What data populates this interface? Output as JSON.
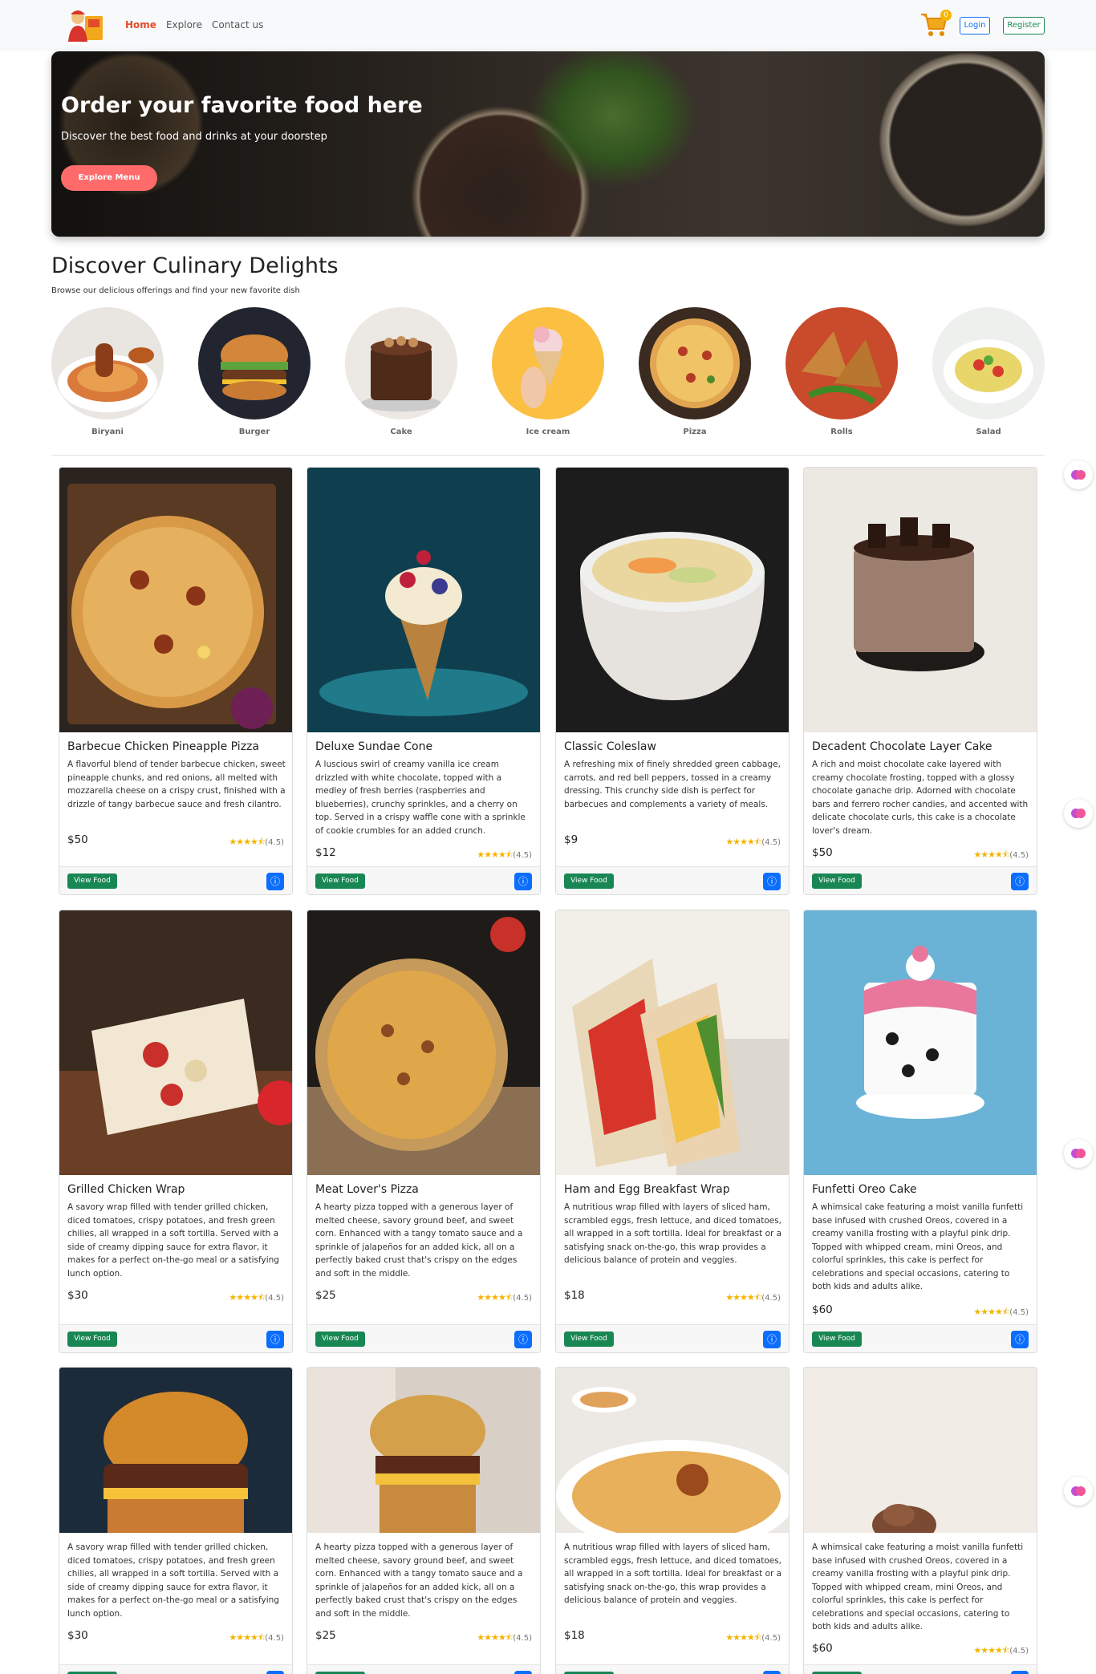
{
  "nav": {
    "links": [
      "Home",
      "Explore",
      "Contact us"
    ],
    "cart_count": "0",
    "login": "Login",
    "register": "Register"
  },
  "hero": {
    "title": "Order your favorite food here",
    "subtitle": "Discover the best food and drinks at your doorstep",
    "button": "Explore Menu"
  },
  "section": {
    "title": "Discover Culinary Delights",
    "subtitle": "Browse our delicious offerings and find your new favorite dish"
  },
  "categories": [
    "Biryani",
    "Burger",
    "Cake",
    "Ice cream",
    "Pizza",
    "Rolls",
    "Salad"
  ],
  "cards": [
    {
      "title": "Barbecue Chicken Pineapple Pizza",
      "desc": "A flavorful blend of tender barbecue chicken, sweet pineapple chunks, and red onions, all melted with mozzarella cheese on a crispy crust, finished with a drizzle of tangy barbecue sauce and fresh cilantro.",
      "price": "$50",
      "rating": "(4.5)"
    },
    {
      "title": "Deluxe Sundae Cone",
      "desc": "A luscious swirl of creamy vanilla ice cream drizzled with white chocolate, topped with a medley of fresh berries (raspberries and blueberries), crunchy sprinkles, and a cherry on top. Served in a crispy waffle cone with a sprinkle of cookie crumbles for an added crunch.",
      "price": "$12",
      "rating": "(4.5)"
    },
    {
      "title": "Classic Coleslaw",
      "desc": "A refreshing mix of finely shredded green cabbage, carrots, and red bell peppers, tossed in a creamy dressing. This crunchy side dish is perfect for barbecues and complements a variety of meals.",
      "price": "$9",
      "rating": "(4.5)"
    },
    {
      "title": "Decadent Chocolate Layer Cake",
      "desc": "A rich and moist chocolate cake layered with creamy chocolate frosting, topped with a glossy chocolate ganache drip. Adorned with chocolate bars and ferrero rocher candies, and accented with delicate chocolate curls, this cake is a chocolate lover's dream.",
      "price": "$50",
      "rating": "(4.5)"
    },
    {
      "title": "Grilled Chicken Wrap",
      "desc": "A savory wrap filled with tender grilled chicken, diced tomatoes, crispy potatoes, and fresh green chilies, all wrapped in a soft tortilla. Served with a side of creamy dipping sauce for extra flavor, it makes for a perfect on-the-go meal or a satisfying lunch option.",
      "price": "$30",
      "rating": "(4.5)"
    },
    {
      "title": "Meat Lover's Pizza",
      "desc": "A hearty pizza topped with a generous layer of melted cheese, savory ground beef, and sweet corn. Enhanced with a tangy tomato sauce and a sprinkle of jalapeños for an added kick, all on a perfectly baked crust that's crispy on the edges and soft in the middle.",
      "price": "$25",
      "rating": "(4.5)"
    },
    {
      "title": "Ham and Egg Breakfast Wrap",
      "desc": "A nutritious wrap filled with layers of sliced ham, scrambled eggs, fresh lettuce, and diced tomatoes, all wrapped in a soft tortilla. Ideal for breakfast or a satisfying snack on-the-go, this wrap provides a delicious balance of protein and veggies.",
      "price": "$18",
      "rating": "(4.5)"
    },
    {
      "title": "Funfetti Oreo Cake",
      "desc": "A whimsical cake featuring a moist vanilla funfetti base infused with crushed Oreos, covered in a creamy vanilla frosting with a playful pink drip. Topped with whipped cream, mini Oreos, and colorful sprinkles, this cake is perfect for celebrations and special occasions, catering to both kids and adults alike.",
      "price": "$60",
      "rating": "(4.5)"
    },
    {
      "title": "",
      "desc": "A savory wrap filled with tender grilled chicken, diced tomatoes, crispy potatoes, and fresh green chilies, all wrapped in a soft tortilla. Served with a side of creamy dipping sauce for extra flavor, it makes for a perfect on-the-go meal or a satisfying lunch option.",
      "price": "$30",
      "rating": "(4.5)"
    },
    {
      "title": "",
      "desc": "A hearty pizza topped with a generous layer of melted cheese, savory ground beef, and sweet corn. Enhanced with a tangy tomato sauce and a sprinkle of jalapeños for an added kick, all on a perfectly baked crust that's crispy on the edges and soft in the middle.",
      "price": "$25",
      "rating": "(4.5)"
    },
    {
      "title": "",
      "desc": "A nutritious wrap filled with layers of sliced ham, scrambled eggs, fresh lettuce, and diced tomatoes, all wrapped in a soft tortilla. Ideal for breakfast or a satisfying snack on-the-go, this wrap provides a delicious balance of protein and veggies.",
      "price": "$18",
      "rating": "(4.5)"
    },
    {
      "title": "",
      "desc": "A whimsical cake featuring a moist vanilla funfetti base infused with crushed Oreos, covered in a creamy vanilla frosting with a playful pink drip. Topped with whipped cream, mini Oreos, and colorful sprinkles, this cake is perfect for celebrations and special occasions, catering to both kids and adults alike.",
      "price": "$60",
      "rating": "(4.5)"
    }
  ],
  "card_ui": {
    "view": "View Food",
    "stars": "★★★★⯪"
  },
  "colors": {
    "accent": "#e24c2a",
    "hero_button": "#ff6b6b",
    "view_button": "#198754",
    "info_button": "#0d6efd",
    "star": "#f5b400"
  },
  "icons": {
    "cart": "cart-icon",
    "info": "info-icon",
    "side": "brain-icon"
  }
}
